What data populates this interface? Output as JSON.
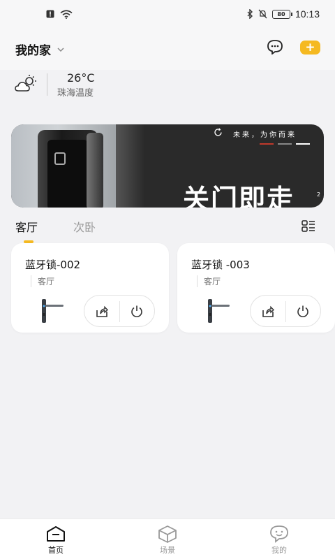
{
  "status_bar": {
    "time": "10:13",
    "battery": "80"
  },
  "header": {
    "home_name": "我的家",
    "accent_color": "#f5b921",
    "add_label": "+"
  },
  "weather": {
    "temperature": "26°C",
    "label": "珠海温度",
    "icon": "partly-cloudy-icon"
  },
  "banner": {
    "slogan": "未来，为你而来",
    "headline": "关门即走",
    "page": "2",
    "dash_colors": [
      "#c0392b",
      "#888888",
      "#ffffff"
    ]
  },
  "rooms": {
    "tabs": [
      {
        "label": "客厅",
        "active": true
      },
      {
        "label": "次卧",
        "active": false
      }
    ]
  },
  "devices": [
    {
      "name": "蓝牙锁-002",
      "room": "客厅"
    },
    {
      "name": "蓝牙锁 -003",
      "room": "客厅"
    }
  ],
  "bottom_nav": {
    "items": [
      {
        "label": "首页",
        "icon": "home-icon",
        "active": true
      },
      {
        "label": "场景",
        "icon": "cube-icon",
        "active": false
      },
      {
        "label": "我的",
        "icon": "profile-icon",
        "active": false
      }
    ]
  }
}
